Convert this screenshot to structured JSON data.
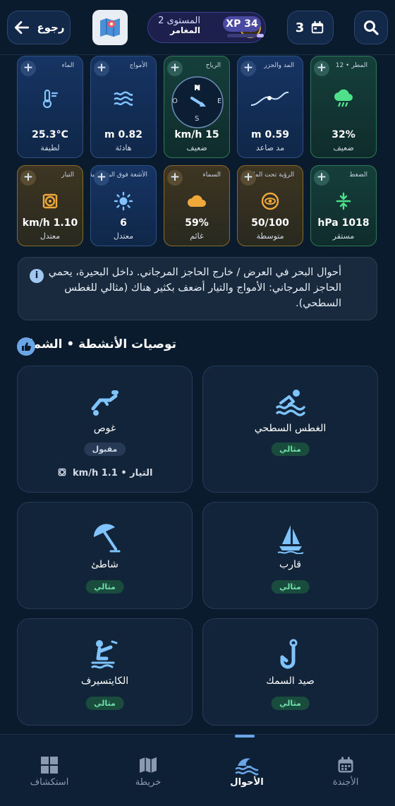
{
  "header": {
    "back_label": "رجوع",
    "level_label": "المستوى 2",
    "rank_label": "المغامر",
    "xp_label": "34 XP",
    "xp_progress": 0.2,
    "calendar_count": "3"
  },
  "conditions_row1": [
    {
      "title": "المطر • 12",
      "value": "32%",
      "sub": "ضعيف",
      "icon": "rain-cloud-icon"
    },
    {
      "title": "المد والجزر",
      "value": "0.59 m",
      "sub": "مد صاعد",
      "icon": "tide-curve-icon"
    },
    {
      "title": "الرياح",
      "value": "15 km/h",
      "sub": "ضعيف",
      "icon": "wind-compass-icon",
      "compass": {
        "n": "N",
        "e": "E",
        "s": "S",
        "w": "O"
      }
    },
    {
      "title": "الأمواج",
      "value": "0.82 m",
      "sub": "هادئة",
      "icon": "waves-icon"
    },
    {
      "title": "الماء",
      "value": "25.3°C",
      "sub": "لطيفة",
      "icon": "thermometer-icon"
    }
  ],
  "conditions_row2": [
    {
      "title": "الضغط",
      "value": "1018 hPa",
      "sub": "مستقر",
      "icon": "pressure-icon"
    },
    {
      "title": "الرؤية تحت الماء",
      "value": "50/100",
      "sub": "متوسطة",
      "icon": "eye-icon"
    },
    {
      "title": "السماء",
      "value": "59%",
      "sub": "غائم",
      "icon": "cloud-icon"
    },
    {
      "title": "الأشعة فوق البنفسجية",
      "value": "6",
      "sub": "معتدل",
      "icon": "sun-icon"
    },
    {
      "title": "التيار",
      "value": "1.10 km/h",
      "sub": "معتدل",
      "icon": "current-icon"
    }
  ],
  "info_text": "أحوال البحر في العرض / خارج الحاجز المرجاني. داخل البحيرة، يحمي الحاجز المرجاني: الأمواج والتيار أضعف بكثير هناك (مثالي للغطس السطحي).",
  "section_title": "توصيات الأنشطة • الشمال",
  "activities": [
    {
      "name": "الغطس السطحي",
      "badge": "مثالي",
      "icon": "swimmer-icon"
    },
    {
      "name": "غوص",
      "badge": "مقبول",
      "icon": "diver-icon",
      "extra": "التيار • 1.1 km/h"
    },
    {
      "name": "قارب",
      "badge": "مثالي",
      "icon": "sailboat-icon"
    },
    {
      "name": "شاطئ",
      "badge": "مثالي",
      "icon": "umbrella-icon"
    },
    {
      "name": "صيد السمك",
      "badge": "مثالي",
      "icon": "fishhook-icon"
    },
    {
      "name": "الكايتسيرف",
      "badge": "مثالي",
      "icon": "kitesurf-icon"
    }
  ],
  "nav": [
    {
      "label": "الأجندة",
      "icon": "calendar-icon"
    },
    {
      "label": "الأحوال",
      "icon": "waves-icon",
      "active": true
    },
    {
      "label": "خريطة",
      "icon": "map-icon"
    },
    {
      "label": "استكشاف",
      "icon": "grid-icon"
    }
  ],
  "colors": {
    "accent": "#6aa6e6",
    "good": "#6fe0a9",
    "card_blue": "#163463",
    "card_green": "#153f3a",
    "card_orange": "#3e3522"
  }
}
